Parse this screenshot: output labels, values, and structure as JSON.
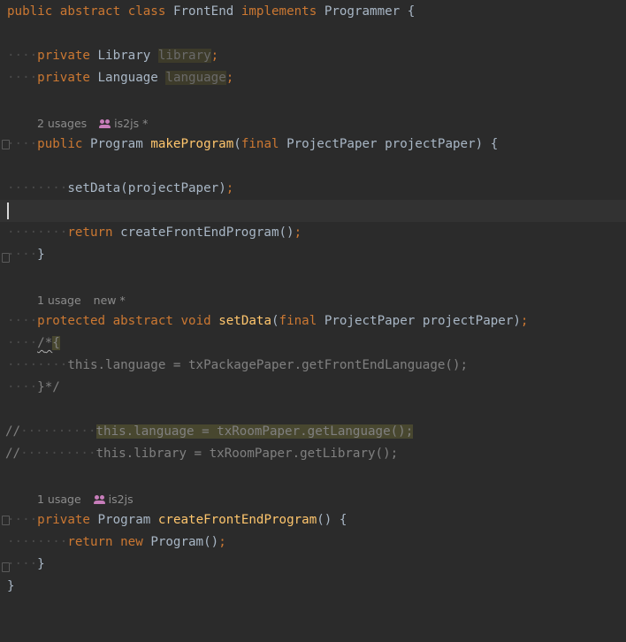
{
  "colors": {
    "background": "#2b2b2b",
    "keyword": "#cc7832",
    "identifier": "#a9b7c6",
    "method": "#ffc66d",
    "field": "#9876aa",
    "comment": "#808080",
    "author_icon": "#c77dba"
  },
  "icons": {
    "author": "users-icon",
    "fold": "fold-marker-icon"
  },
  "lines": {
    "l1": {
      "kw1": "public",
      "kw2": "abstract",
      "kw3": "class",
      "name": "FrontEnd",
      "kw4": "implements",
      "iface": "Programmer",
      "brace": "{"
    },
    "l3": {
      "ws": "····",
      "kw": "private",
      "type": "Library",
      "field": "library",
      "semi": ";"
    },
    "l4": {
      "ws": "····",
      "kw": "private",
      "type": "Language",
      "field": "language",
      "semi": ";"
    },
    "h1": {
      "usages": "2 usages",
      "author": "is2js *"
    },
    "l6": {
      "ws": "····",
      "kw": "public",
      "type": "Program",
      "method": "makeProgram",
      "open": "(",
      "kw2": "final",
      "ptype": "ProjectPaper",
      "param": "projectPaper",
      "close": ")",
      "brace": "{"
    },
    "l8": {
      "ws": "········",
      "method": "setData",
      "open": "(",
      "arg": "projectPaper",
      "close": ")",
      "semi": ";"
    },
    "l10": {
      "ws": "········",
      "kw": "return",
      "call": "createFrontEndProgram",
      "parens": "()",
      "semi": ";"
    },
    "l11": {
      "ws": "····",
      "brace": "}"
    },
    "h2": {
      "usages": "1 usage",
      "author": "new *"
    },
    "l13": {
      "ws": "····",
      "kw1": "protected",
      "kw2": "abstract",
      "kw3": "void",
      "method": "setData",
      "open": "(",
      "kw4": "final",
      "ptype": "ProjectPaper",
      "param": "projectPaper",
      "close": ")",
      "semi": ";"
    },
    "l14": {
      "ws": "····",
      "slash": "/",
      "star": "*",
      "brace": "{"
    },
    "l15": {
      "ws": "········",
      "code": "this.language = txPackagePaper.getFrontEndLanguage();"
    },
    "l16": {
      "ws": "····",
      "code": "}*/"
    },
    "l18": {
      "prefix": "//",
      "ws": "··········",
      "code": "this.language = txRoomPaper.getLanguage();"
    },
    "l19": {
      "prefix": "//",
      "ws": "··········",
      "code": "this.library = txRoomPaper.getLibrary();"
    },
    "h3": {
      "usages": "1 usage",
      "author": "is2js"
    },
    "l21": {
      "ws": "····",
      "kw": "private",
      "type": "Program",
      "method": "createFrontEndProgram",
      "parens": "()",
      "brace": "{"
    },
    "l22": {
      "ws": "········",
      "kw1": "return",
      "kw2": "new",
      "call": "Program",
      "parens": "()",
      "semi": ";"
    },
    "l23": {
      "ws": "····",
      "brace": "}"
    },
    "l24": {
      "brace": "}"
    }
  }
}
